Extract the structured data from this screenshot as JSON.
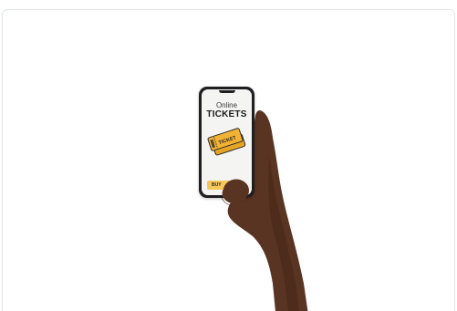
{
  "phone": {
    "title": "Online",
    "heading": "TICKETS",
    "ticket_label": "TICKET",
    "buy_label": "BUY"
  },
  "colors": {
    "skin": "#5a3422",
    "skin_shadow": "#3f2317",
    "ticket": "#f2b233",
    "ticket_dark": "#2b2b2b",
    "buy_button": "#f7c75a"
  },
  "icons": {
    "ticket": "ticket-icon"
  }
}
